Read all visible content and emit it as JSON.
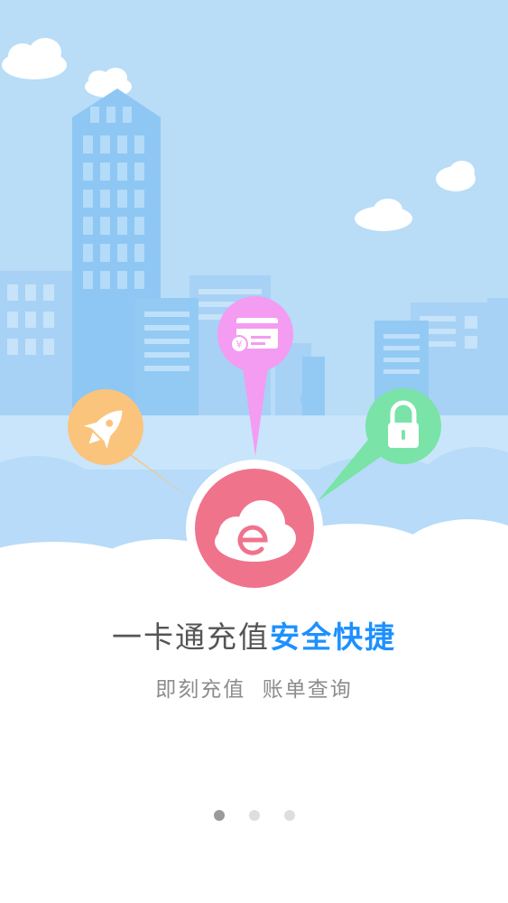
{
  "headline": {
    "plain": "一卡通充值",
    "accent": "安全快捷"
  },
  "subtitle": "即刻充值  账单查询",
  "icons": {
    "center": "cloud-e-logo-icon",
    "left": "rocket-icon",
    "top": "card-payment-icon",
    "right": "padlock-icon"
  },
  "colors": {
    "sky": "#b9dcf7",
    "buildings": "#8ec7f3",
    "center_pin": "#f0738c",
    "rocket_pin": "#fbc47c",
    "card_pin": "#f39cf1",
    "lock_pin": "#7ae3a7",
    "accent_text": "#1e90ff"
  },
  "pager": {
    "pages": 3,
    "active_index": 0
  }
}
